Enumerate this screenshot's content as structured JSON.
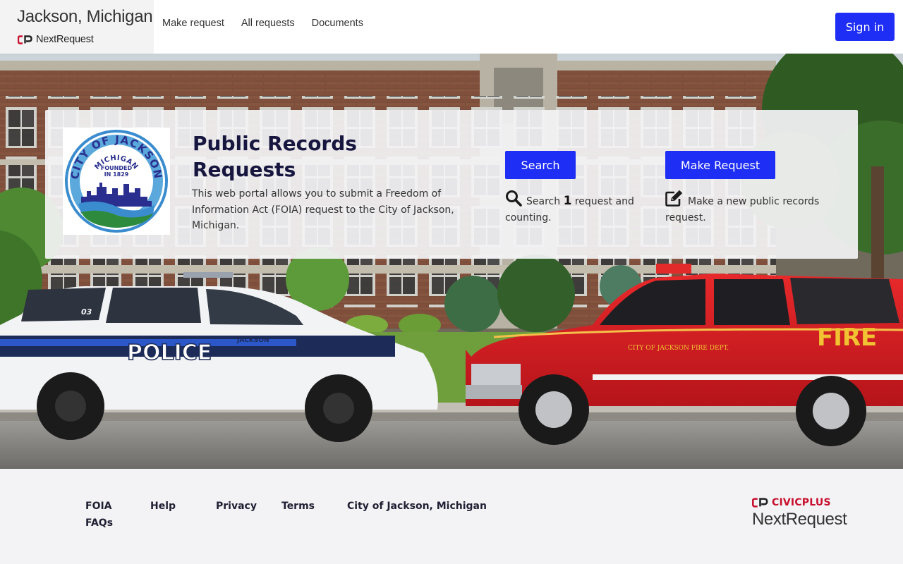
{
  "header": {
    "city_name": "Jackson, Michigan",
    "product_name": "NextRequest",
    "nav": [
      {
        "label": "Make request"
      },
      {
        "label": "All requests"
      },
      {
        "label": "Documents"
      }
    ],
    "sign_in_label": "Sign in"
  },
  "hero": {
    "title": "Public Records Requests",
    "description": "This web portal allows you to submit a Freedom of Information Act (FOIA) request to the City of Jackson, Michigan.",
    "seal": {
      "top_text": "CITY OF JACKSON",
      "state": "MICHIGAN",
      "founded": "FOUNDED",
      "year": "IN 1829"
    },
    "search": {
      "button_label": "Search",
      "text_before": "Search",
      "count": "1",
      "text_after": "request and counting."
    },
    "make_request": {
      "button_label": "Make Request",
      "text": "Make a new public records request."
    },
    "photo": {
      "police_label": "POLICE",
      "police_city": "JACKSON",
      "police_unit": "03",
      "fire_label": "FIRE",
      "fire_dept": "CITY OF JACKSON FIRE DEPT."
    }
  },
  "footer": {
    "links": {
      "foia_faqs": "FOIA FAQs",
      "help": "Help",
      "privacy": "Privacy",
      "terms": "Terms",
      "city": "City of Jackson, Michigan"
    },
    "vendor": "CIVICPLUS",
    "vendor_product": "NextRequest"
  },
  "colors": {
    "primary": "#1f2ef5",
    "title_text": "#17163f",
    "vendor_red": "#c8102e",
    "seal_blue": "#2a2f8f",
    "seal_green": "#2e8b3e"
  }
}
